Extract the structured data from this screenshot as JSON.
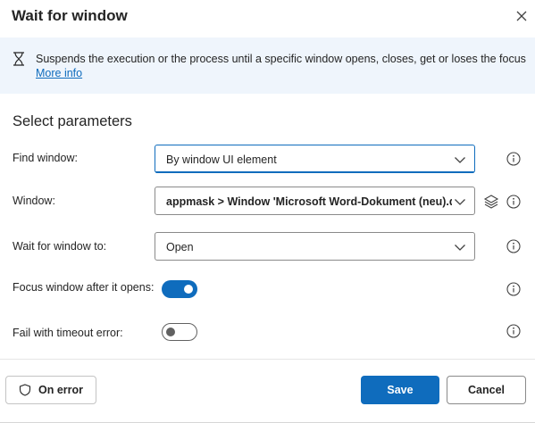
{
  "dialog": {
    "title": "Wait for window",
    "close_icon": "close-icon"
  },
  "banner": {
    "icon": "hourglass-icon",
    "text": "Suspends the execution or the process until a specific window opens, closes, get or loses the focus",
    "link": "More info"
  },
  "section_title": "Select parameters",
  "params": {
    "find_window": {
      "label": "Find window:",
      "value": "By window UI element"
    },
    "window": {
      "label": "Window:",
      "value": "appmask > Window 'Microsoft Word-Dokument (neu).docx"
    },
    "wait_for": {
      "label": "Wait for window to:",
      "value": "Open"
    },
    "focus_window": {
      "label": "Focus window after it opens:",
      "on": true
    },
    "fail_timeout": {
      "label": "Fail with timeout error:",
      "on": false
    }
  },
  "footer": {
    "on_error": "On error",
    "save": "Save",
    "cancel": "Cancel"
  },
  "colors": {
    "accent": "#0f6cbd",
    "banner_bg": "#eff5fc"
  }
}
